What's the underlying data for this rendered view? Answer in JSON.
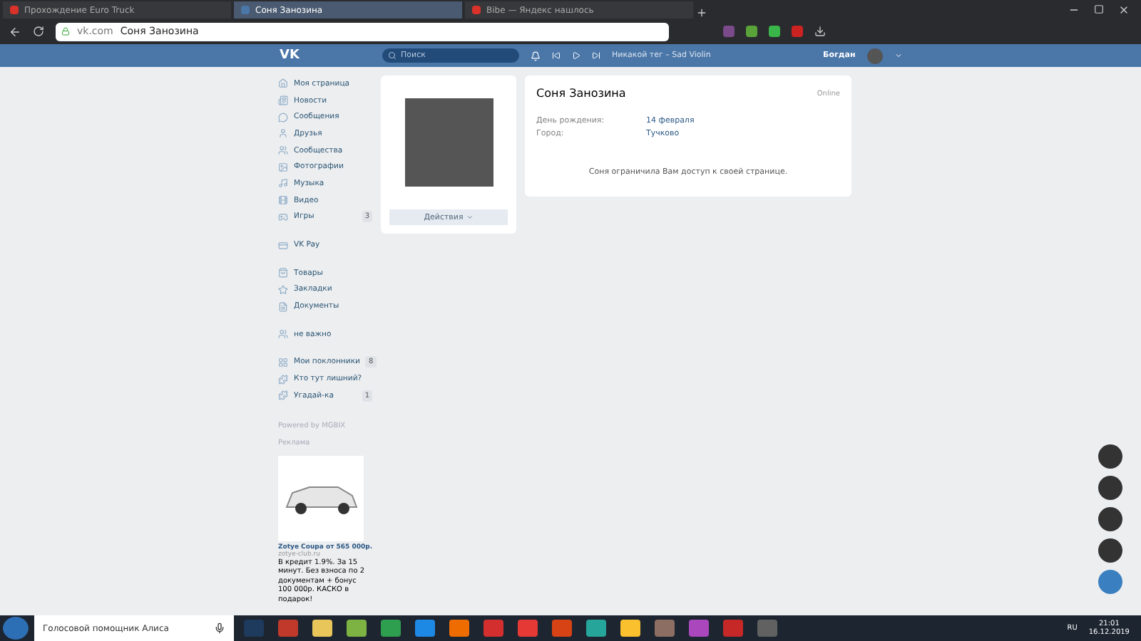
{
  "browser": {
    "tabs": [
      {
        "title": "Прохождение Euro Truck",
        "selected": false,
        "color": "#d9322b"
      },
      {
        "title": "Соня Занозина",
        "selected": true,
        "color": "#4a76a8"
      },
      {
        "title": "Вibe — Яндекс нашлось",
        "selected": false,
        "color": "#d9322b"
      }
    ],
    "address": {
      "domain": "vk.com",
      "title": "Соня Занозина"
    }
  },
  "header": {
    "logo": "VK",
    "search": {
      "placeholder": "Поиск"
    },
    "track": "Никакой тег – Sad Violin",
    "user": "Богдан"
  },
  "sidebar": {
    "groups": [
      [
        {
          "label": "Моя страница"
        },
        {
          "label": "Новости"
        },
        {
          "label": "Сообщения"
        },
        {
          "label": "Друзья"
        },
        {
          "label": "Сообщества"
        },
        {
          "label": "Фотографии"
        },
        {
          "label": "Музыка"
        },
        {
          "label": "Видео"
        },
        {
          "label": "Игры",
          "badge": "3"
        }
      ],
      [
        {
          "label": "VK Pay"
        }
      ],
      [
        {
          "label": "Товары"
        },
        {
          "label": "Закладки"
        },
        {
          "label": "Документы"
        }
      ],
      [
        {
          "label": "не важно"
        }
      ],
      [
        {
          "label": "Мои поклонники",
          "badge": "8"
        },
        {
          "label": "Кто тут лишний?"
        },
        {
          "label": "Угадай-ка",
          "badge": "1"
        }
      ]
    ],
    "powered": "Powered by MGBIX",
    "ads_label": "Реклама",
    "ad": {
      "title": "Zotye Coupa от 565 000р.",
      "site": "zotye-club.ru",
      "text": "В кредит 1.9%. За 15 минут. Без взноса по 2 документам + бонус 100 000р. КАСКО в подарок!"
    }
  },
  "profile": {
    "actions": "Действия",
    "name": "Соня Занозина",
    "status": "Online",
    "fields": [
      {
        "label": "День рождения:",
        "value": "14 февраля"
      },
      {
        "label": "Город:",
        "value": "Тучково"
      }
    ],
    "notice": "Соня ограничила Вам доступ к своей странице."
  },
  "taskbar": {
    "search": "Голосовой помощник Алиса",
    "apps": [
      {
        "color": "#1e3a5c"
      },
      {
        "color": "#c0392b"
      },
      {
        "color": "#e8c65a"
      },
      {
        "color": "#7cb342"
      },
      {
        "color": "#2e9e4f"
      },
      {
        "color": "#1e88e5"
      },
      {
        "color": "#ef6c00"
      },
      {
        "color": "#d32f2f"
      },
      {
        "color": "#e53935"
      },
      {
        "color": "#d84315"
      },
      {
        "color": "#26a69a"
      },
      {
        "color": "#fbc02d"
      },
      {
        "color": "#8d6e63"
      },
      {
        "color": "#ab47bc"
      },
      {
        "color": "#c62828"
      },
      {
        "color": "#616161"
      }
    ],
    "lang": "RU",
    "time": "21:01",
    "date": "16.12.2019"
  }
}
